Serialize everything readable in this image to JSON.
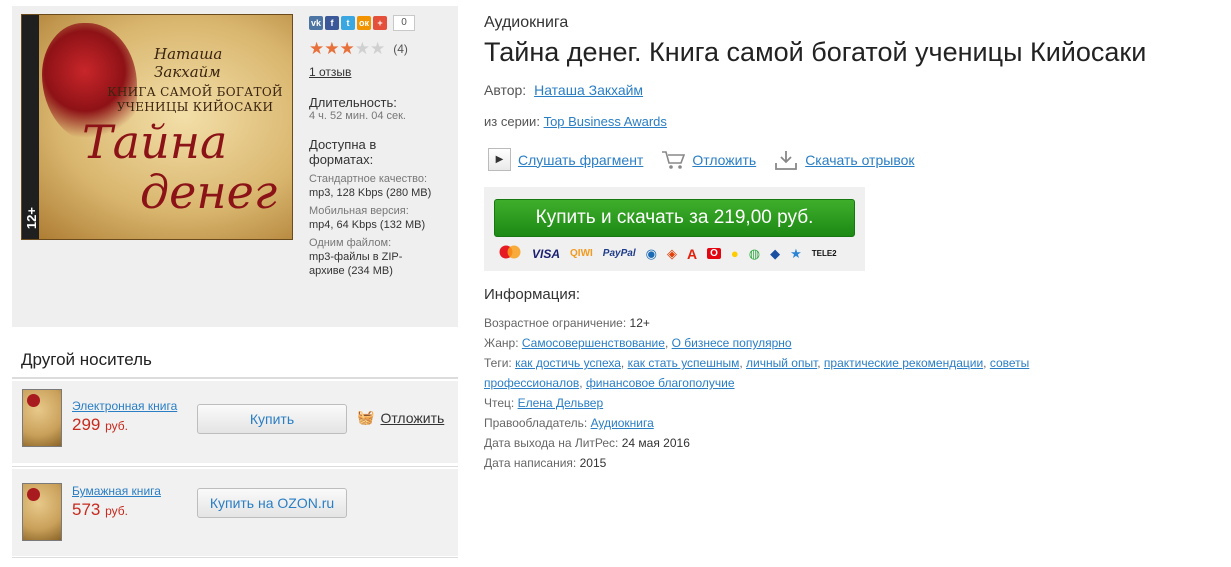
{
  "cover": {
    "author": "Наташа Закхайм",
    "subtitle": "КНИГА САМОЙ БОГАТОЙ УЧЕНИЦЫ КИЙОСАКИ",
    "title_line1": "Тайна",
    "title_line2": "денег",
    "age": "12+"
  },
  "share": {
    "count": "0",
    "icons": [
      "vk-icon",
      "facebook-icon",
      "twitter-icon",
      "odnoklassniki-icon",
      "plus-icon"
    ]
  },
  "rating": {
    "stars": 3,
    "max": 5,
    "count": "(4)"
  },
  "reviews_link": "1 отзыв",
  "duration": {
    "label": "Длительность:",
    "value": "4 ч. 52 мин. 04 сек."
  },
  "formats": {
    "heading": "Доступна в форматах:",
    "items": [
      {
        "label": "Стандартное качество:",
        "value": "mp3, 128 Kbps (280 MB)"
      },
      {
        "label": "Мобильная версия:",
        "value": "mp4, 64 Kbps (132 MB)"
      },
      {
        "label": "Одним файлом:",
        "value": "mp3-файлы в ZIP-архиве (234 MB)"
      }
    ]
  },
  "other_media": {
    "title": "Другой носитель",
    "items": [
      {
        "type": "Электронная книга",
        "price": "299",
        "currency": "руб.",
        "button": "Купить",
        "defer": "Отложить"
      },
      {
        "type": "Бумажная книга",
        "price": "573",
        "currency": "руб.",
        "button": "Купить на OZON.ru"
      }
    ]
  },
  "book": {
    "kind": "Аудиокнига",
    "title": "Тайна денег. Книга самой богатой ученицы Кийосаки",
    "author_label": "Автор:",
    "author": "Наташа Закхайм",
    "series_label": "из серии:",
    "series": "Top Business Awards"
  },
  "actions": {
    "listen": "Слушать фрагмент",
    "defer": "Отложить",
    "download": "Скачать отрывок"
  },
  "buy": {
    "button": "Купить и скачать за 219,00 руб.",
    "payment_methods": [
      "MasterCard",
      "VISA",
      "QIWI",
      "PayPal",
      "WebMoney",
      "Яндекс",
      "Альфа",
      "МТС",
      "Билайн",
      "Мегафон",
      "Сбербанк",
      "Связной",
      "TELE2"
    ]
  },
  "info": {
    "heading": "Информация:",
    "age_label": "Возрастное ограничение:",
    "age": "12+",
    "genre_label": "Жанр:",
    "genres": [
      "Самосовершенствование",
      "О бизнесе популярно"
    ],
    "tags_label": "Теги:",
    "tags": [
      "как достичь успеха",
      "как стать успешным",
      "личный опыт",
      "практические рекомендации",
      "советы профессионалов",
      "финансовое благополучие"
    ],
    "reader_label": "Чтец:",
    "reader": "Елена Дельвер",
    "rights_label": "Правообладатель:",
    "rights": "Аудиокнига",
    "release_label": "Дата выхода на ЛитРес:",
    "release": "24 мая 2016",
    "written_label": "Дата написания:",
    "written": "2015"
  },
  "colors": {
    "buy_green": "#22911a",
    "link": "#2a7ec4",
    "price": "#c62b1e",
    "star": "#e8703a"
  }
}
